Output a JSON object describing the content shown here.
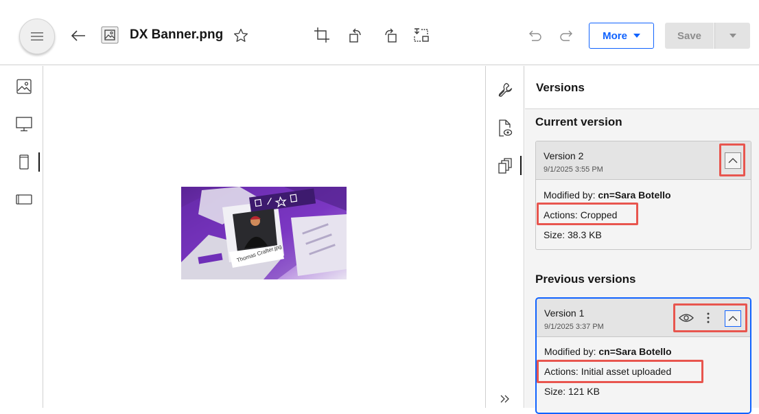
{
  "toolbar": {
    "filename": "DX Banner.png",
    "more_label": "More",
    "save_label": "Save"
  },
  "versions_panel": {
    "title": "Versions",
    "current_section": "Current version",
    "previous_section": "Previous versions",
    "current": {
      "name": "Version 2",
      "date": "9/1/2025 3:55 PM",
      "modified_label": "Modified by:",
      "modified_by": "cn=Sara Botello",
      "actions": "Actions: Cropped",
      "size": "Size: 38.3 KB"
    },
    "previous": [
      {
        "name": "Version 1",
        "date": "9/1/2025 3:37 PM",
        "modified_label": "Modified by:",
        "modified_by": "cn=Sara Botello",
        "actions": "Actions: Initial asset uploaded",
        "size": "Size: 121 KB"
      }
    ]
  },
  "thumbnail": {
    "caption": "Thomas Crafter.jpg"
  },
  "colors": {
    "accent": "#0f62fe",
    "highlight": "#e8554e",
    "thumb_purple": "#7b2fbe"
  },
  "icons": {
    "toolbar": [
      "hamburger-menu-icon",
      "back-arrow-icon",
      "image-file-icon",
      "star-icon",
      "crop-icon",
      "rotate-left-icon",
      "rotate-right-icon",
      "resize-icon",
      "undo-icon",
      "redo-icon",
      "caret-down-icon"
    ],
    "left_rail": [
      "image-icon",
      "desktop-icon",
      "mobile-icon",
      "tablet-icon"
    ],
    "right_rail": [
      "wrench-icon",
      "file-preview-icon",
      "versions-icon",
      "expand-panel-icon"
    ]
  }
}
